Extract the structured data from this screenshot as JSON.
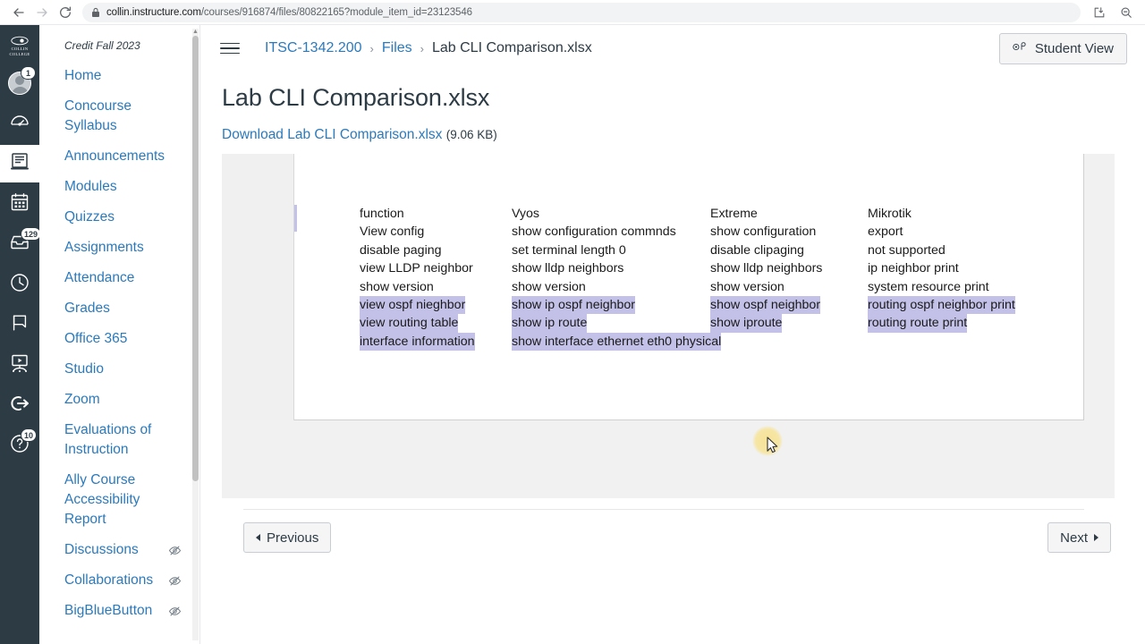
{
  "browser": {
    "url_host": "collin.instructure.com",
    "url_path": "/courses/916874/files/80822165?module_item_id=23123546",
    "back_icon": "back-arrow-icon",
    "forward_icon": "forward-arrow-icon",
    "reload_icon": "reload-icon",
    "lock_icon": "lock-icon",
    "install_icon": "install-app-icon",
    "zoom_icon": "zoom-search-icon"
  },
  "global_nav": {
    "logo_line1": "COLLIN",
    "logo_line2": "COLLEGE",
    "items": [
      {
        "name": "account",
        "icon": "user-avatar-icon",
        "badge": "1"
      },
      {
        "name": "dashboard",
        "icon": "dashboard-speedometer-icon",
        "badge": ""
      },
      {
        "name": "courses",
        "icon": "courses-book-icon",
        "badge": "",
        "active": true
      },
      {
        "name": "calendar",
        "icon": "calendar-icon",
        "badge": ""
      },
      {
        "name": "inbox",
        "icon": "inbox-tray-icon",
        "badge": "129"
      },
      {
        "name": "history",
        "icon": "clock-history-icon",
        "badge": ""
      },
      {
        "name": "commons",
        "icon": "bookmark-flag-icon",
        "badge": ""
      },
      {
        "name": "studio",
        "icon": "studio-screen-icon",
        "badge": ""
      },
      {
        "name": "logout",
        "icon": "logout-arrow-icon",
        "badge": ""
      },
      {
        "name": "help",
        "icon": "help-question-icon",
        "badge": "10"
      }
    ]
  },
  "course_nav": {
    "term": "Credit Fall 2023",
    "items": [
      {
        "label": "Home",
        "hidden_icon": false
      },
      {
        "label": "Concourse Syllabus",
        "hidden_icon": false
      },
      {
        "label": "Announcements",
        "hidden_icon": false
      },
      {
        "label": "Modules",
        "hidden_icon": false
      },
      {
        "label": "Quizzes",
        "hidden_icon": false
      },
      {
        "label": "Assignments",
        "hidden_icon": false
      },
      {
        "label": "Attendance",
        "hidden_icon": false
      },
      {
        "label": "Grades",
        "hidden_icon": false
      },
      {
        "label": "Office 365",
        "hidden_icon": false
      },
      {
        "label": "Studio",
        "hidden_icon": false
      },
      {
        "label": "Zoom",
        "hidden_icon": false
      },
      {
        "label": "Evaluations of Instruction",
        "hidden_icon": false
      },
      {
        "label": "Ally Course Accessibility Report",
        "hidden_icon": false
      },
      {
        "label": "Discussions",
        "hidden_icon": true
      },
      {
        "label": "Collaborations",
        "hidden_icon": true
      },
      {
        "label": "BigBlueButton",
        "hidden_icon": true
      }
    ]
  },
  "topbar": {
    "menu_icon": "hamburger-menu-icon",
    "breadcrumb": [
      {
        "label": "ITSC-1342.200",
        "current": false
      },
      {
        "label": "Files",
        "current": false
      },
      {
        "label": "Lab CLI Comparison.xlsx",
        "current": true
      }
    ],
    "student_view_label": "Student View",
    "student_view_icon": "eye-student-view-icon"
  },
  "file": {
    "title": "Lab CLI Comparison.xlsx",
    "download_label": "Download Lab CLI Comparison.xlsx",
    "size": "(9.06 KB)"
  },
  "footer": {
    "previous_label": "Previous",
    "next_label": "Next",
    "previous_icon": "triangle-left-icon",
    "next_icon": "triangle-right-icon"
  },
  "colors": {
    "link": "#2b7abc",
    "nav_dark": "#2d3b45",
    "highlight": "#c3c1e8",
    "cursor_halo": "#f7e292"
  },
  "spreadsheet": {
    "columns": [
      {
        "header": "function",
        "cells": [
          {
            "text": "View config",
            "highlight": false
          },
          {
            "text": "disable paging",
            "highlight": false
          },
          {
            "text": "view LLDP neighbor",
            "highlight": false
          },
          {
            "text": "show version",
            "highlight": false
          },
          {
            "text": "view ospf nieghbor",
            "highlight": true
          },
          {
            "text": "view routing table",
            "highlight": true
          },
          {
            "text": "interface information",
            "highlight": true
          }
        ]
      },
      {
        "header": "Vyos",
        "cells": [
          {
            "text": "show configuration commnds",
            "highlight": false
          },
          {
            "text": "set terminal length 0",
            "highlight": false
          },
          {
            "text": "show lldp neighbors",
            "highlight": false
          },
          {
            "text": "show version",
            "highlight": false
          },
          {
            "text": "show ip ospf neighbor",
            "highlight": true
          },
          {
            "text": "show ip route",
            "highlight": true
          },
          {
            "text": "show interface ethernet eth0 physical",
            "highlight": true
          }
        ]
      },
      {
        "header": "Extreme",
        "cells": [
          {
            "text": "show configuration",
            "highlight": false
          },
          {
            "text": "disable clipaging",
            "highlight": false
          },
          {
            "text": "show lldp neighbors",
            "highlight": false
          },
          {
            "text": "show version",
            "highlight": false
          },
          {
            "text": "show ospf neighbor",
            "highlight": true
          },
          {
            "text": "show iproute",
            "highlight": true
          },
          {
            "text": "",
            "highlight": false
          }
        ]
      },
      {
        "header": "Mikrotik",
        "cells": [
          {
            "text": "export",
            "highlight": false
          },
          {
            "text": "not supported",
            "highlight": false
          },
          {
            "text": "ip neighbor print",
            "highlight": false
          },
          {
            "text": "system resource print",
            "highlight": false
          },
          {
            "text": "routing ospf neighbor print",
            "highlight": true
          },
          {
            "text": "routing route print",
            "highlight": true
          },
          {
            "text": "",
            "highlight": false
          }
        ]
      }
    ]
  }
}
